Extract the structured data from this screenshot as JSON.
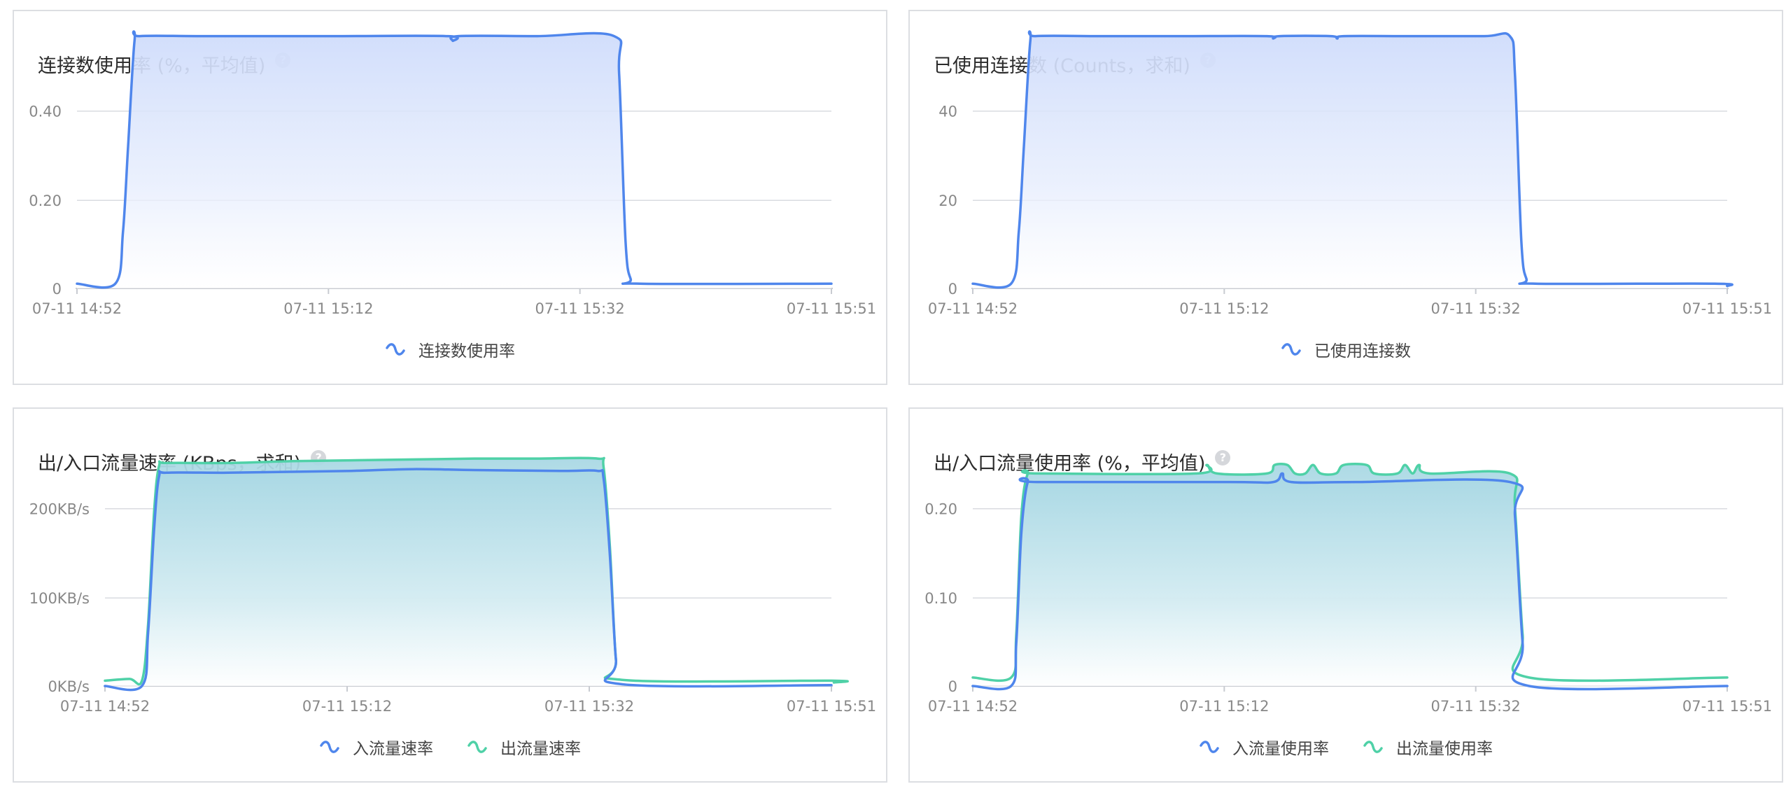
{
  "chart_data": [
    {
      "type": "area",
      "title": "连接数使用率 (%，平均值)",
      "x_ticks": [
        "07-11 14:52",
        "07-11 15:12",
        "07-11 15:32",
        "07-11 15:51"
      ],
      "y_ticks": [
        "0",
        "0.20",
        "0.40"
      ],
      "ylim": [
        0,
        0.5
      ],
      "grid": true,
      "legend_position": "bottom",
      "series": [
        {
          "name": "连接数使用率",
          "color": "#4f86ec",
          "points": [
            [
              0,
              0.01
            ],
            [
              3,
              0.01
            ],
            [
              3.6,
              0.12
            ],
            [
              4,
              0.3
            ],
            [
              4.5,
              0.52
            ],
            [
              4.9,
              0.53
            ],
            [
              10,
              0.53
            ],
            [
              20,
              0.53
            ],
            [
              29,
              0.53
            ],
            [
              29.4,
              0.52
            ],
            [
              29.8,
              0.53
            ],
            [
              36,
              0.53
            ],
            [
              42,
              0.53
            ],
            [
              42.4,
              0.45
            ],
            [
              42.9,
              0.1
            ],
            [
              43.3,
              0.02
            ],
            [
              44,
              0.01
            ],
            [
              59,
              0.01
            ]
          ]
        }
      ]
    },
    {
      "type": "area",
      "title": "已使用连接数 (Counts，求和)",
      "x_ticks": [
        "07-11 14:52",
        "07-11 15:12",
        "07-11 15:32",
        "07-11 15:51"
      ],
      "y_ticks": [
        "0",
        "20",
        "40"
      ],
      "ylim": [
        0,
        50
      ],
      "grid": true,
      "legend_position": "bottom",
      "series": [
        {
          "name": "已使用连接数",
          "color": "#4f86ec",
          "points": [
            [
              0,
              1
            ],
            [
              3,
              1
            ],
            [
              3.6,
              12
            ],
            [
              4,
              30
            ],
            [
              4.5,
              52
            ],
            [
              4.9,
              53
            ],
            [
              10,
              53
            ],
            [
              16,
              53
            ],
            [
              23,
              53
            ],
            [
              23.5,
              52.5
            ],
            [
              24,
              53
            ],
            [
              28,
              53
            ],
            [
              28.5,
              52.5
            ],
            [
              29,
              53
            ],
            [
              34,
              53
            ],
            [
              40,
              53
            ],
            [
              42,
              53
            ],
            [
              42.4,
              45
            ],
            [
              42.9,
              10
            ],
            [
              43.3,
              2
            ],
            [
              44,
              1
            ],
            [
              58,
              1
            ],
            [
              59,
              0.5
            ]
          ]
        }
      ]
    },
    {
      "type": "area",
      "title": "出/入口流量速率 (KBps，求和)",
      "x_ticks": [
        "07-11 14:52",
        "07-11 15:12",
        "07-11 15:32",
        "07-11 15:51"
      ],
      "y_ticks": [
        "0KB/s",
        "100KB/s",
        "200KB/s"
      ],
      "ylim": [
        0,
        270
      ],
      "grid": true,
      "legend_position": "bottom",
      "series": [
        {
          "name": "入流量速率",
          "color": "#4f86ec",
          "points": [
            [
              0,
              0
            ],
            [
              3,
              0
            ],
            [
              3.5,
              60
            ],
            [
              4,
              180
            ],
            [
              4.4,
              238
            ],
            [
              5,
              242
            ],
            [
              10,
              242
            ],
            [
              15,
              243
            ],
            [
              20,
              244
            ],
            [
              25,
              246
            ],
            [
              30,
              245
            ],
            [
              37,
              244
            ],
            [
              40,
              244
            ],
            [
              40.5,
              235
            ],
            [
              41,
              150
            ],
            [
              41.5,
              30
            ],
            [
              42,
              2
            ],
            [
              59,
              1
            ]
          ]
        },
        {
          "name": "出流量速率",
          "color": "#4fd1a7",
          "points": [
            [
              0,
              6
            ],
            [
              2,
              8
            ],
            [
              3,
              6
            ],
            [
              3.5,
              70
            ],
            [
              4,
              200
            ],
            [
              4.4,
              250
            ],
            [
              5,
              253
            ],
            [
              10,
              253
            ],
            [
              15,
              255
            ],
            [
              20,
              256
            ],
            [
              25,
              257
            ],
            [
              30,
              258
            ],
            [
              35,
              258
            ],
            [
              40,
              258
            ],
            [
              40.5,
              248
            ],
            [
              41,
              160
            ],
            [
              41.5,
              30
            ],
            [
              42,
              7
            ],
            [
              59,
              6
            ],
            [
              59.2,
              4
            ]
          ]
        }
      ]
    },
    {
      "type": "area",
      "title": "出/入口流量使用率 (%，平均值)",
      "x_ticks": [
        "07-11 14:52",
        "07-11 15:12",
        "07-11 15:32",
        "07-11 15:51"
      ],
      "y_ticks": [
        "0",
        "0.10",
        "0.20"
      ],
      "ylim": [
        0,
        0.28
      ],
      "grid": true,
      "legend_position": "bottom",
      "series": [
        {
          "name": "入流量使用率",
          "color": "#4f86ec",
          "points": [
            [
              0,
              0
            ],
            [
              3,
              0
            ],
            [
              3.4,
              0.05
            ],
            [
              3.8,
              0.18
            ],
            [
              4.3,
              0.24
            ],
            [
              5,
              0.24
            ],
            [
              20,
              0.24
            ],
            [
              23.5,
              0.24
            ],
            [
              24.2,
              0.25
            ],
            [
              24.9,
              0.24
            ],
            [
              30,
              0.24
            ],
            [
              42,
              0.24
            ],
            [
              42.4,
              0.2
            ],
            [
              43,
              0.05
            ],
            [
              43.5,
              0
            ],
            [
              59,
              0
            ]
          ]
        },
        {
          "name": "出流量使用率",
          "color": "#4fd1a7",
          "points": [
            [
              0,
              0.01
            ],
            [
              3,
              0.01
            ],
            [
              3.4,
              0.06
            ],
            [
              3.8,
              0.2
            ],
            [
              4.3,
              0.25
            ],
            [
              5,
              0.25
            ],
            [
              17.5,
              0.25
            ],
            [
              18.3,
              0.26
            ],
            [
              19.1,
              0.25
            ],
            [
              23,
              0.25
            ],
            [
              23.6,
              0.26
            ],
            [
              24.6,
              0.26
            ],
            [
              25.2,
              0.25
            ],
            [
              26,
              0.25
            ],
            [
              26.6,
              0.26
            ],
            [
              27.2,
              0.25
            ],
            [
              28.4,
              0.25
            ],
            [
              29,
              0.26
            ],
            [
              30.8,
              0.26
            ],
            [
              31.4,
              0.25
            ],
            [
              33.2,
              0.25
            ],
            [
              33.8,
              0.26
            ],
            [
              34.4,
              0.25
            ],
            [
              34.9,
              0.26
            ],
            [
              35.7,
              0.25
            ],
            [
              42,
              0.25
            ],
            [
              42.4,
              0.21
            ],
            [
              43,
              0.06
            ],
            [
              43.5,
              0.01
            ],
            [
              59,
              0.01
            ]
          ]
        }
      ]
    }
  ]
}
